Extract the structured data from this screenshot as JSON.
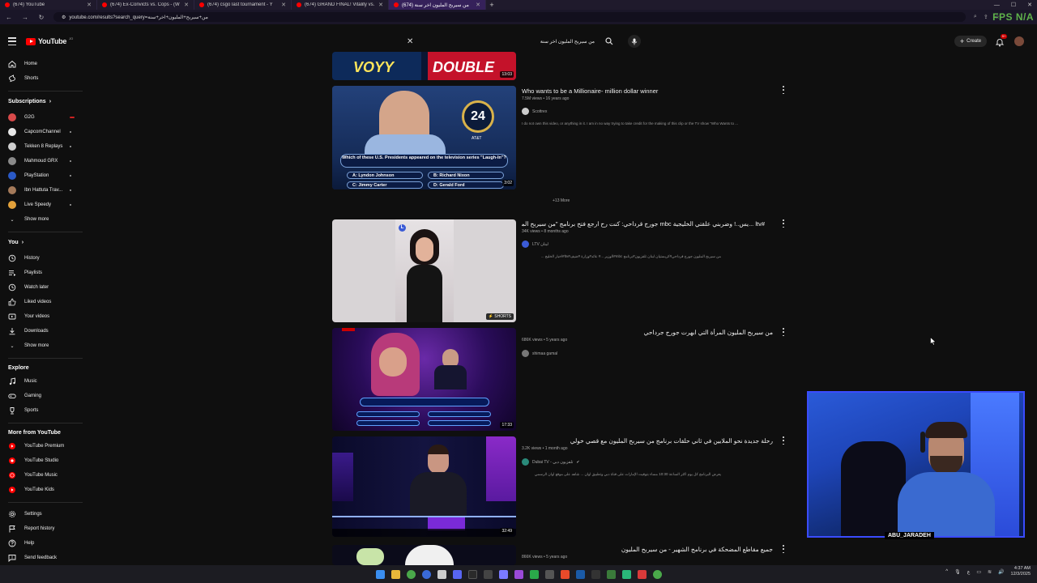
{
  "browser": {
    "tabs": [
      {
        "title": "(674) YouTube",
        "active": false
      },
      {
        "title": "(674) Ex-Convicts vs. Cops - (W",
        "active": false
      },
      {
        "title": "(674) csgo last tournament - Y",
        "active": false
      },
      {
        "title": "(674) GRAND FINAL! Vitality vs.",
        "active": false
      },
      {
        "title": "(674) من سيربح المليون اخر سنة",
        "active": true
      }
    ],
    "url": "youtube.com/results?search_query=من+سيربح+المليون+اخر+سنة",
    "overlay_fps": "FPS",
    "overlay_na": "N/A"
  },
  "masthead": {
    "logo_text": "YouTube",
    "country": "JO",
    "search_query": "من سيربح المليون اخر سنة",
    "create_label": "Create",
    "notifications": "9+"
  },
  "sidebar": {
    "main": [
      {
        "label": "Home",
        "icon": "home-icon"
      },
      {
        "label": "Shorts",
        "icon": "shorts-icon"
      }
    ],
    "subscriptions_header": "Subscriptions",
    "subscriptions": [
      {
        "label": "G2G",
        "color": "#d84a4a"
      },
      {
        "label": "CapcomChannel",
        "color": "#e8e8e8"
      },
      {
        "label": "Tekken 8 Replays",
        "color": "#cfcfcf"
      },
      {
        "label": "Mahmoud GRX",
        "color": "#8a8a8a"
      },
      {
        "label": "PlayStation",
        "color": "#2a59c6"
      },
      {
        "label": "Ibn Hattuta Trav...",
        "color": "#a47a5a"
      },
      {
        "label": "Live Speedy",
        "color": "#e3a13a"
      }
    ],
    "subs_show_more": "Show more",
    "you_header": "You",
    "you_items": [
      {
        "label": "History",
        "icon": "history-icon"
      },
      {
        "label": "Playlists",
        "icon": "playlists-icon"
      },
      {
        "label": "Watch later",
        "icon": "watch-later-icon"
      },
      {
        "label": "Liked videos",
        "icon": "thumbs-up-icon"
      },
      {
        "label": "Your videos",
        "icon": "your-videos-icon"
      },
      {
        "label": "Downloads",
        "icon": "download-icon"
      }
    ],
    "you_show_more": "Show more",
    "explore_header": "Explore",
    "explore_items": [
      {
        "label": "Music",
        "icon": "music-icon"
      },
      {
        "label": "Gaming",
        "icon": "gaming-icon"
      },
      {
        "label": "Sports",
        "icon": "trophy-icon"
      }
    ],
    "more_header": "More from YouTube",
    "more_items": [
      {
        "label": "YouTube Premium"
      },
      {
        "label": "YouTube Studio"
      },
      {
        "label": "YouTube Music"
      },
      {
        "label": "YouTube Kids"
      }
    ],
    "footer_items": [
      {
        "label": "Settings",
        "icon": "gear-icon"
      },
      {
        "label": "Report history",
        "icon": "flag-icon"
      },
      {
        "label": "Help",
        "icon": "help-icon"
      },
      {
        "label": "Send feedback",
        "icon": "feedback-icon"
      }
    ]
  },
  "results": {
    "top_partial": {
      "left_text": "VOYY",
      "right_text": "DOUBLE",
      "duration": "13:03"
    },
    "videos": [
      {
        "title": "Who wants to be a Millionaire- million dollar winner",
        "meta": "7.5M views • 16 years ago",
        "channel": "Scottrex",
        "description": "I do not own this video, or anything in it. I am in no way trying to take credit for the making of this clip or the TV show \"Who Wants to ...",
        "duration": "3:02",
        "question": "Which of these U.S. Presidents appeared on the television series \"Laugh-In\"?",
        "answers": [
          "A: Lyndon Johnson",
          "B: Richard Nixon",
          "C: Jimmy Carter",
          "D: Gerald Ford"
        ],
        "counter": "24",
        "sponsor": "AT&T",
        "badge_color": "#cccccc"
      },
      {
        "title": "#ltv ...يس..! وضربني علقتي الخليجية mbc جورج قرداحي: كنت رح ارجع فتح برنامج \"من سيربح المليون\" على",
        "meta": "34K views • 8 months ago",
        "channel": "LTV لبنان",
        "description": "من سيربح المليون جورج قرداحي#كريستيان لبنان تلفزيون#برنامج mbc#الوزير ...# عائد#وزارة #ضيف#ltv#اخبار الخليج ...",
        "duration": "SHORTS",
        "badge_color": "#3b5bd6"
      },
      {
        "title": "من سيربح المليون المرأة التي ابهرت جورج جرداحي",
        "meta": "686K views • 5 years ago",
        "channel": "shimaa gamal",
        "description": "",
        "duration": "17:33",
        "badge_color": "#777777"
      },
      {
        "title": "رحلة جديدة نحو الملايين في ثاني حلقات برنامج من سيربح المليون مع قصي خولي",
        "meta": "3.2K views • 1 month ago",
        "channel": "Dubai TV - تلفزيون دبي",
        "description": "يعرض البرنامج كل يوم أكثر الساعة 10:30 مساء بتوقيت الإمارات على قناة دبي وتطبيق أوان ... شاهد على موقع أوان الرسمي",
        "duration": "32:49",
        "badge_color": "#2a8a7a"
      },
      {
        "title": "جميع مقاطع المضحكة في برنامج الشهير - من سيربح المليون",
        "meta": "866K views • 5 years ago",
        "channel": "",
        "description": "",
        "duration": "",
        "badge_color": "#888888"
      }
    ],
    "more_label": "+13 More"
  },
  "webcam": {
    "label": "ABU_JARADEH"
  },
  "taskbar": {
    "time": "4:37 AM",
    "date": "12/3/2025",
    "lang": "ع"
  }
}
